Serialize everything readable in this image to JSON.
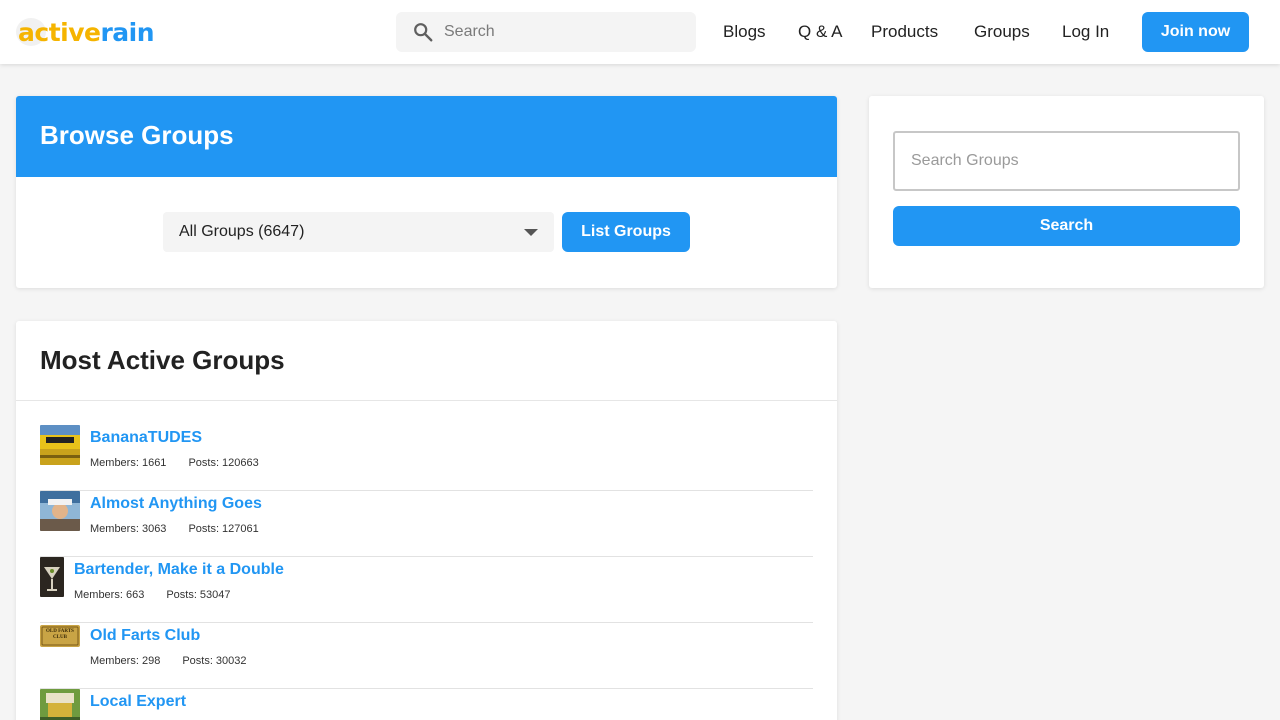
{
  "header": {
    "logo_part1": "active",
    "logo_part2": "rain",
    "search_placeholder": "Search",
    "nav": [
      "Blogs",
      "Q & A",
      "Products",
      "Groups",
      "Log In"
    ],
    "join_label": "Join now"
  },
  "browse": {
    "title": "Browse Groups",
    "select_value": "All Groups (6647)",
    "list_button": "List Groups"
  },
  "sidebar": {
    "search_placeholder": "Search Groups",
    "search_button": "Search"
  },
  "active_groups": {
    "title": "Most Active Groups",
    "groups": [
      {
        "name": "BananaTUDES",
        "members": "Members: 1661",
        "posts": "Posts: 120663"
      },
      {
        "name": "Almost Anything Goes",
        "members": "Members: 3063",
        "posts": "Posts: 127061"
      },
      {
        "name": "Bartender, Make it a Double",
        "members": "Members: 663",
        "posts": "Posts: 53047"
      },
      {
        "name": "Old Farts Club",
        "members": "Members: 298",
        "posts": "Posts: 30032",
        "thumb_text": "OLD FARTS CLUB"
      },
      {
        "name": "Local Expert",
        "members": "",
        "posts": ""
      }
    ]
  },
  "colors": {
    "brand_blue": "#2196f3",
    "brand_yellow": "#f5b400"
  }
}
